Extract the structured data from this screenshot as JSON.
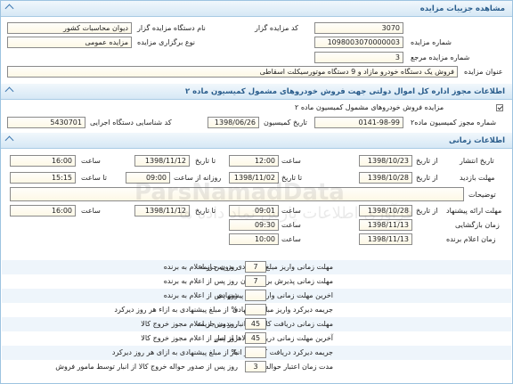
{
  "details": {
    "header": "مشاهده جزییات مزایده",
    "code_label": "کد مزایده گزار",
    "code_value": "3070",
    "device_label": "نام دستگاه مزایده گزار",
    "device_value": "دیوان محاسبات کشور",
    "number_label": "شماره مزایده",
    "number_value": "1098003070000003",
    "type_label": "نوع برگزاری مزایده",
    "type_value": "مزایده عمومی",
    "ref_label": "شماره مزایده مرجع",
    "ref_value": "3",
    "title_label": "عنوان مزایده",
    "title_value": "فروش یک دستگاه خودرو مازاد و 9 دستگاه موتورسیکلت اسقاطی"
  },
  "gov": {
    "header": "اطلاعات مجوز اداره کل اموال دولتی جهت فروش خودروهای مشمول کمیسیون ماده ۲",
    "check_label": "مزایده فروش خودروهای مشمول کمیسیون ماده ۲",
    "permit_label": "شماره مجوز کمیسیون ماده۲",
    "permit_value": "0141-98-99",
    "commission_date_label": "تاریخ کمیسیون",
    "commission_date_value": "1398/06/26",
    "exec_label": "کد شناسایی دستگاه اجرایی",
    "exec_value": "5430701"
  },
  "timing": {
    "header": "اطلاعات زمانی",
    "publish_label": "تاریخ انتشار",
    "publish_from_label": "از تاریخ",
    "publish_from": "1398/10/23",
    "time_label": "ساعت",
    "publish_from_time": "12:00",
    "to_date_label": "تا تاریخ",
    "publish_to": "1398/11/12",
    "publish_to_time": "16:00",
    "visit_label": "مهلت بازدید",
    "visit_from_label": "از تاریخ",
    "visit_from": "1398/10/28",
    "visit_to_label": "تا تاریخ",
    "visit_to": "1398/11/02",
    "daily_label": "روزانه از ساعت",
    "daily_from": "09:00",
    "daily_to_label": "تا ساعت",
    "daily_to": "15:15",
    "notes_label": "توضیحات",
    "notes_value": "",
    "offer_label": "مهلت ارائه پیشنهاد",
    "offer_from_label": "از تاریخ",
    "offer_from": "1398/10/28",
    "offer_from_time": "09:01",
    "offer_to_label": "تا تاریخ",
    "offer_to": "1398/11/12",
    "offer_to_time": "16:00",
    "opening_label": "زمان بازگشایی",
    "opening_date": "1398/11/13",
    "opening_time": "09:30",
    "winner_label": "زمان اعلام برنده",
    "winner_date": "1398/11/13",
    "winner_time": "10:00"
  },
  "deadlines": [
    {
      "label": "مهلت زمانی واریز مبلغ پیشنهادی بدون جریمه",
      "value": "7",
      "unit": "روز پس از اعلام به برنده"
    },
    {
      "label": "مهلت زمانی پذیرش برنده بودن",
      "value": "7",
      "unit": "روز پس از اعلام به برنده"
    },
    {
      "label": "اخرین مهلت زمانی واریز مبلغ پیشنهادی",
      "value": "",
      "unit": "روز پس از اعلام به برنده"
    },
    {
      "label": "جریمه دیرکرد واریز مبلغ پیشنهادی",
      "value": "",
      "unit": "% از مبلغ پیشنهادی به ازاء هر روز دیرکرد"
    },
    {
      "label": "مهلت زمانی دریافت کالاها از انبار بدون جریمه",
      "value": "45",
      "unit": "روز پس از اعلام مجوز خروج کالا"
    },
    {
      "label": "آخرین مهلت زمانی دریافت کالاها از انبار",
      "value": "45",
      "unit": "روز پس از اعلام مجوز خروج کالا"
    },
    {
      "label": "جریمه دیرکرد دریافت کالاها از انبار",
      "value": "",
      "unit": "% از مبلغ پیشنهادی به ازای هر روز دیرکرد"
    },
    {
      "label": "مدت زمان اعتبار حواله خروج",
      "value": "3",
      "unit": "روز پس از صدور حواله خروج کالا از انبار توسط مامور فروش"
    }
  ],
  "watermark": {
    "line1": "ParsNamadData",
    "line2": "فرآوری اطلاعات پارس نماد داده ها"
  }
}
